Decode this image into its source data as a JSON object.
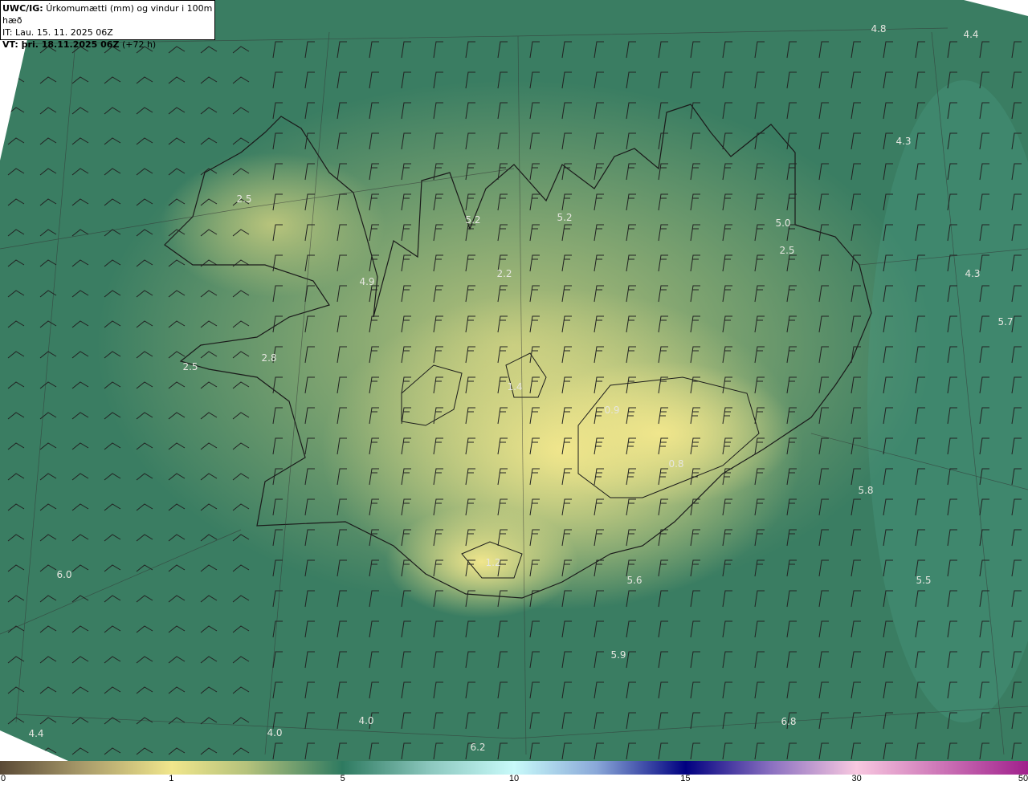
{
  "header": {
    "model": "UWC/IG:",
    "field": "Úrkomumætti (mm) og vindur i 100m hæð",
    "initial_time": "IT: Lau. 15. 11. 2025 06Z",
    "valid_time_label": "VT: þri. 18.11.2025 06Z",
    "lead_time": "(+72 h)"
  },
  "map": {
    "field_values": [
      "4.8",
      "4.4",
      "4.3",
      "2.5",
      "5.2",
      "5.2",
      "5.0",
      "2.5",
      "4.3",
      "5.7",
      "4.9",
      "2.2",
      "2.8",
      "2.5",
      "1.4",
      "0.9",
      "0.8",
      "5.8",
      "1.2",
      "5.6",
      "5.5",
      "6.0",
      "5.9",
      "6.8",
      "4.4",
      "4.0",
      "4.0",
      "6.2"
    ],
    "colors": {
      "low": "#f0e68c",
      "mid": "#2e7a60",
      "coast": "#1a1a1a"
    }
  },
  "colorbar": {
    "ticks": [
      "0",
      "1",
      "5",
      "10",
      "15",
      "30",
      "50"
    ]
  }
}
